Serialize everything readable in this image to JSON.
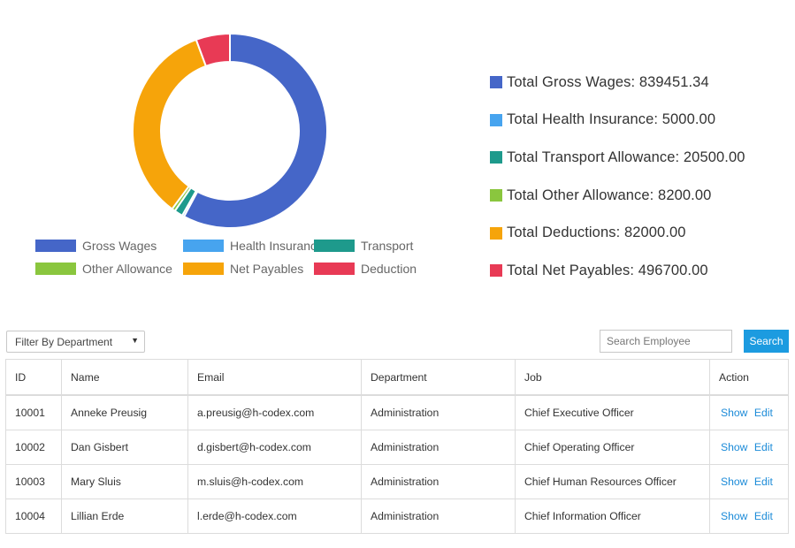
{
  "chart_data": {
    "type": "doughnut",
    "slices": [
      {
        "label": "Gross Wages",
        "value": 839451.34,
        "color": "#4566c8"
      },
      {
        "label": "Health Insurance",
        "value": 5000.0,
        "color": "#47a4ef"
      },
      {
        "label": "Transport",
        "value": 20500.0,
        "color": "#1e9a8c"
      },
      {
        "label": "Other Allowance",
        "value": 8200.0,
        "color": "#8ac63e"
      },
      {
        "label": "Net Payables",
        "value": 496700.0,
        "color": "#f6a40a"
      },
      {
        "label": "Deduction",
        "value": 82000.0,
        "color": "#e83a55"
      }
    ],
    "legend_position": "bottom"
  },
  "summary": [
    {
      "text": "Total Gross Wages: 839451.34",
      "color": "#4566c8"
    },
    {
      "text": "Total Health Insurance: 5000.00",
      "color": "#47a4ef"
    },
    {
      "text": "Total Transport Allowance: 20500.00",
      "color": "#1e9a8c"
    },
    {
      "text": "Total Other Allowance: 8200.00",
      "color": "#8ac63e"
    },
    {
      "text": "Total Deductions: 82000.00",
      "color": "#f6a40a"
    },
    {
      "text": "Total Net Payables: 496700.00",
      "color": "#e83a55"
    }
  ],
  "filter": {
    "label": "Filter By Department"
  },
  "search": {
    "placeholder": "Search Employee",
    "button_label": "Search"
  },
  "table": {
    "headers": {
      "id": "ID",
      "name": "Name",
      "email": "Email",
      "department": "Department",
      "job": "Job",
      "action": "Action"
    },
    "rows": [
      {
        "id": "10001",
        "name": "Anneke Preusig",
        "email": "a.preusig@h-codex.com",
        "department": "Administration",
        "job": "Chief Executive Officer",
        "show": "Show",
        "edit": "Edit"
      },
      {
        "id": "10002",
        "name": "Dan Gisbert",
        "email": "d.gisbert@h-codex.com",
        "department": "Administration",
        "job": "Chief Operating Officer",
        "show": "Show",
        "edit": "Edit"
      },
      {
        "id": "10003",
        "name": "Mary Sluis",
        "email": "m.sluis@h-codex.com",
        "department": "Administration",
        "job": "Chief Human Resources Officer",
        "show": "Show",
        "edit": "Edit"
      },
      {
        "id": "10004",
        "name": "Lillian Erde",
        "email": "l.erde@h-codex.com",
        "department": "Administration",
        "job": "Chief Information Officer",
        "show": "Show",
        "edit": "Edit"
      }
    ]
  }
}
